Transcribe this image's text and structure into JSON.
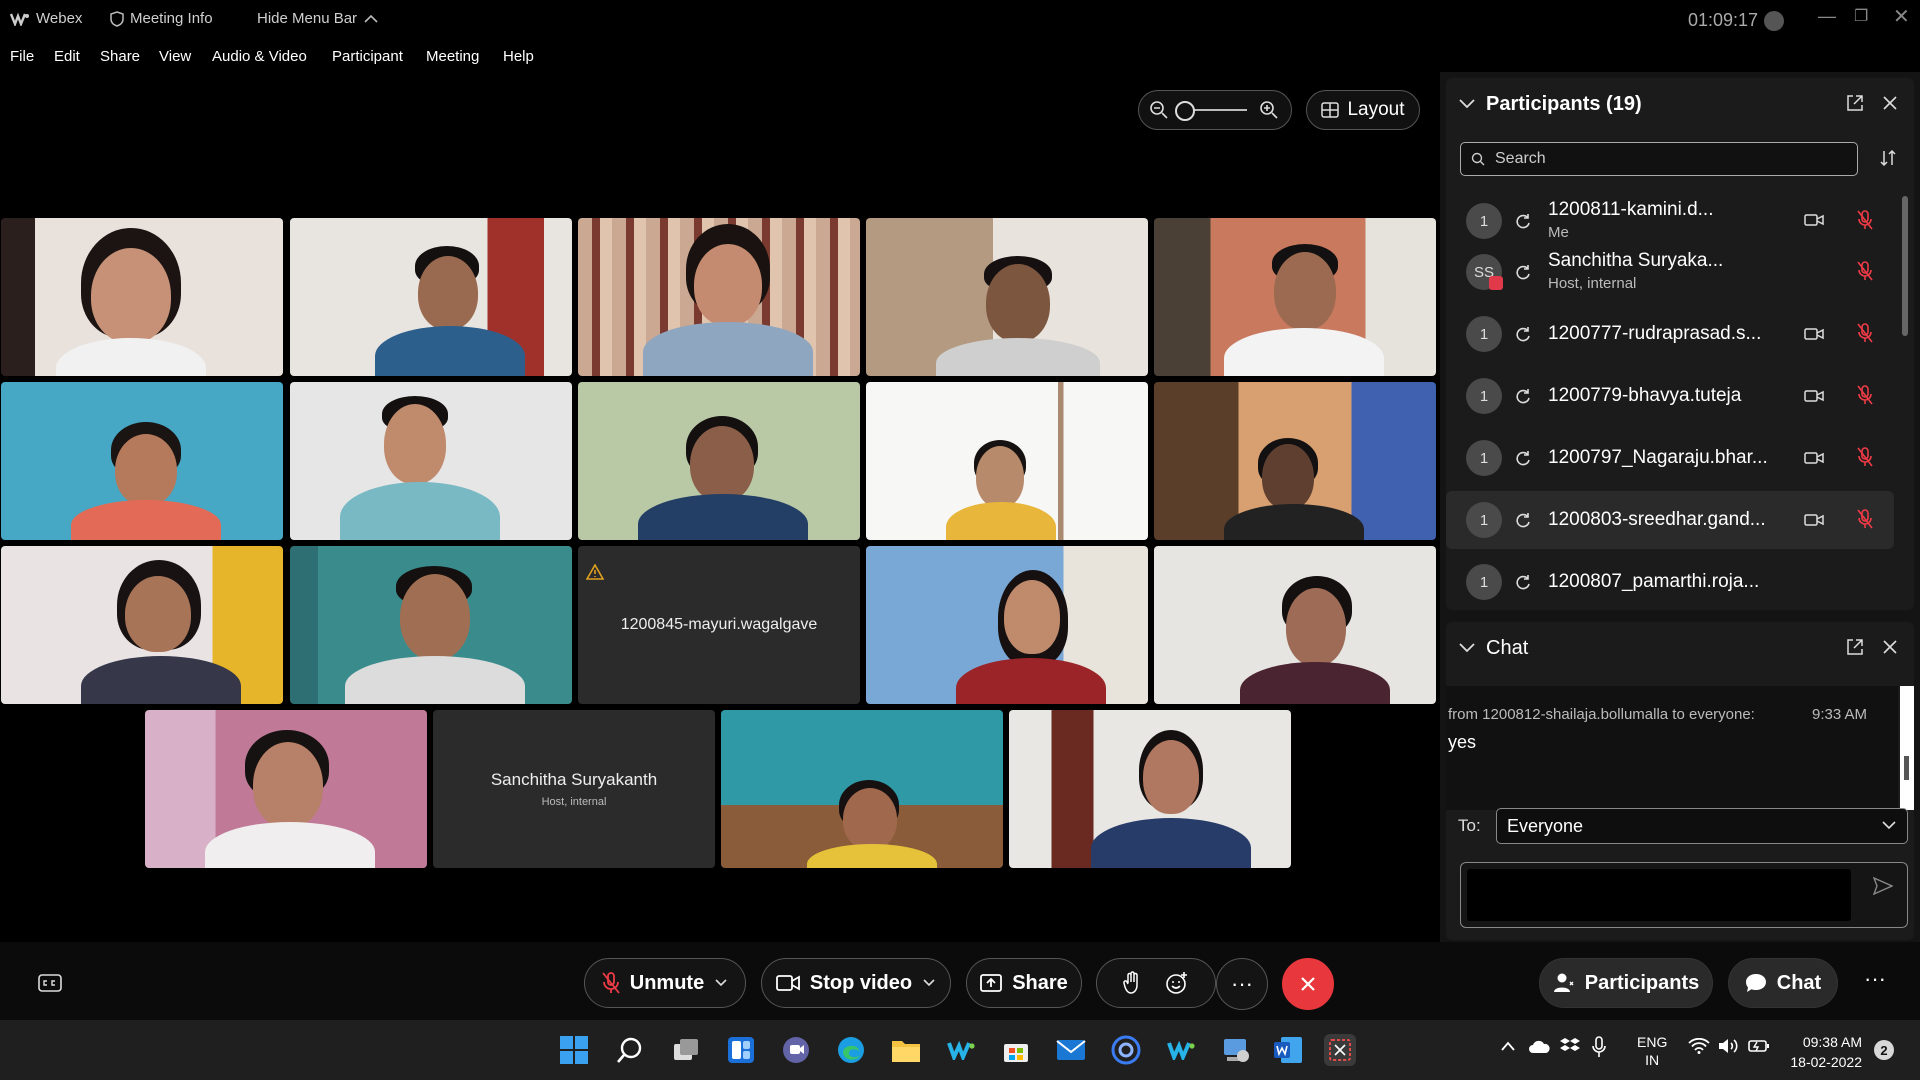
{
  "titlebar": {
    "app_name": "Webex",
    "meeting_info": "Meeting Info",
    "hide_menu_bar": "Hide Menu Bar",
    "timer": "01:09:17"
  },
  "menu": [
    "File",
    "Edit",
    "Share",
    "View",
    "Audio & Video",
    "Participant",
    "Meeting",
    "Help"
  ],
  "view_controls": {
    "layout_label": "Layout"
  },
  "video_tiles": [
    {
      "name": ""
    },
    {
      "name": ""
    },
    {
      "name": ""
    },
    {
      "name": ""
    },
    {
      "name": ""
    },
    {
      "name": ""
    },
    {
      "name": ""
    },
    {
      "name": ""
    },
    {
      "name": ""
    },
    {
      "name": ""
    },
    {
      "name": ""
    },
    {
      "name": ""
    },
    {
      "name": "1200845-mayuri.wagalgave"
    },
    {
      "name": ""
    },
    {
      "name": ""
    },
    {
      "name": ""
    },
    {
      "name": "Sanchitha Suryakanth",
      "role": "Host, internal"
    },
    {
      "name": ""
    },
    {
      "name": ""
    }
  ],
  "participants": {
    "title": "Participants (19)",
    "search_placeholder": "Search",
    "list": [
      {
        "avatar": "1",
        "name": "1200811-kamini.d...",
        "role": "Me"
      },
      {
        "avatar": "SS",
        "name": "Sanchitha Suryaka...",
        "role": "Host, internal"
      },
      {
        "avatar": "1",
        "name": "1200777-rudraprasad.s...",
        "role": ""
      },
      {
        "avatar": "1",
        "name": "1200779-bhavya.tuteja",
        "role": ""
      },
      {
        "avatar": "1",
        "name": "1200797_Nagaraju.bhar...",
        "role": ""
      },
      {
        "avatar": "1",
        "name": "1200803-sreedhar.gand...",
        "role": ""
      },
      {
        "avatar": "1",
        "name": "1200807_pamarthi.roja...",
        "role": ""
      }
    ]
  },
  "chat": {
    "title": "Chat",
    "message_header": "from 1200812-shailaja.bollumalla to everyone:",
    "message_time": "9:33 AM",
    "message_text": "yes",
    "to_label": "To:",
    "to_value": "Everyone"
  },
  "controls": {
    "unmute": "Unmute",
    "stop_video": "Stop video",
    "share": "Share",
    "participants": "Participants",
    "chat": "Chat"
  },
  "system_tray": {
    "lang_line1": "ENG",
    "lang_line2": "IN",
    "time": "09:38 AM",
    "date": "18-02-2022",
    "notifications": "2"
  },
  "colors": {
    "end_call": "#e8383d",
    "panel": "#1b1b1b",
    "accent_blue": "#0f6cbd"
  }
}
